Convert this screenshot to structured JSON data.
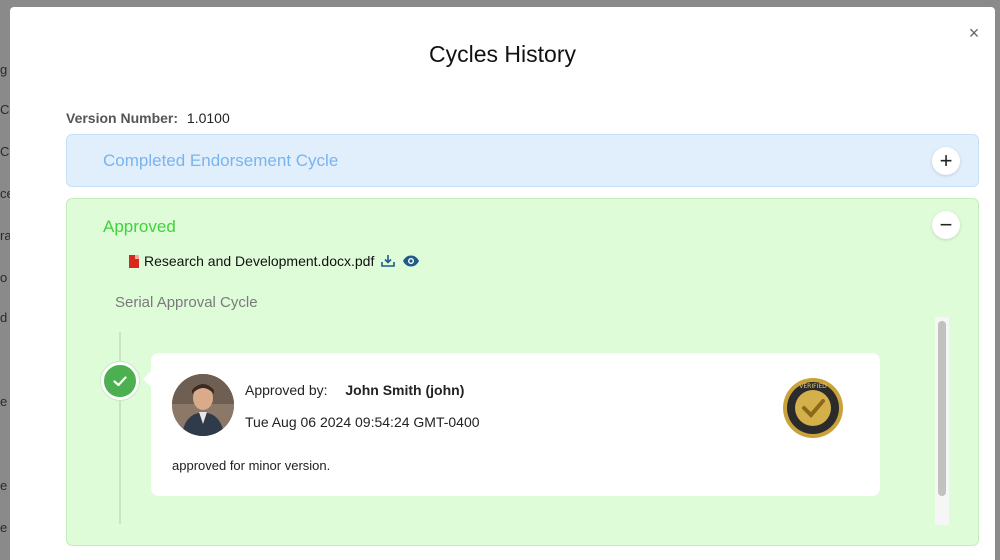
{
  "background": {
    "left_fragments": [
      "g",
      "Co",
      "C",
      "ce",
      "ra",
      "o",
      "d",
      "e",
      "e",
      "e"
    ]
  },
  "modal": {
    "title": "Cycles History",
    "close_icon": "×"
  },
  "version": {
    "label": "Version Number:",
    "value": "1.0100"
  },
  "panels": {
    "completed": {
      "title": "Completed Endorsement Cycle",
      "toggle": "+"
    },
    "approved": {
      "title": "Approved",
      "toggle": "−",
      "file_name": "Research and Development.docx.pdf",
      "cycle_label": "Serial Approval Cycle",
      "entry": {
        "approved_by_label": "Approved by:",
        "approver": "John Smith (john)",
        "date": "Tue Aug 06 2024 09:54:24 GMT-0400",
        "comment": "approved for minor version.",
        "seal_text": "VERIFIED"
      }
    }
  },
  "colors": {
    "completed_bg": "#e1effd",
    "completed_text": "#7ab4ec",
    "approved_bg": "#dffcd9",
    "approved_text": "#3fd23a",
    "check_green": "#4caf50",
    "seal_gold": "#c9a23a"
  },
  "icons": {
    "close": "close-icon",
    "expand": "plus-icon",
    "collapse": "minus-icon",
    "file": "pdf-file-icon",
    "download": "download-icon",
    "view": "eye-icon",
    "status": "check-icon",
    "seal": "verified-seal-icon"
  }
}
